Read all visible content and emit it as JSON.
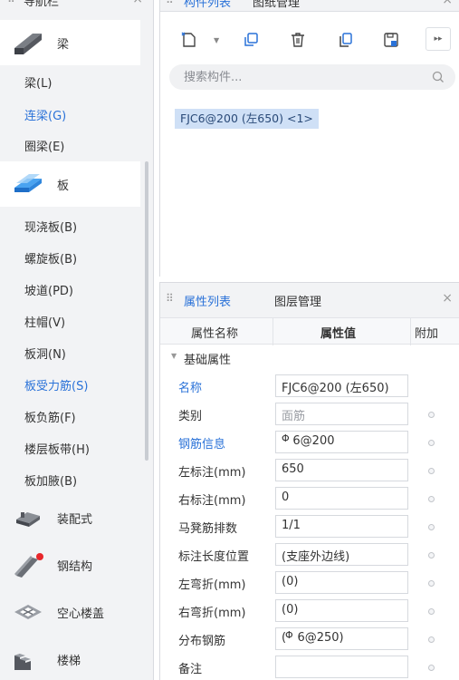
{
  "nav": {
    "title": "导航栏",
    "close": "×",
    "categories": [
      {
        "label": "梁"
      },
      {
        "label": "板"
      },
      {
        "label": "装配式"
      },
      {
        "label": "钢结构"
      },
      {
        "label": "空心楼盖"
      },
      {
        "label": "楼梯"
      }
    ],
    "beam_items": [
      {
        "label": "梁(L)"
      },
      {
        "label": "连梁(G)"
      },
      {
        "label": "圈梁(E)"
      }
    ],
    "slab_items": [
      {
        "label": "现浇板(B)"
      },
      {
        "label": "螺旋板(B)"
      },
      {
        "label": "坡道(PD)"
      },
      {
        "label": "柱帽(V)"
      },
      {
        "label": "板洞(N)"
      },
      {
        "label": "板受力筋(S)"
      },
      {
        "label": "板负筋(F)"
      },
      {
        "label": "楼层板带(H)"
      },
      {
        "label": "板加腋(B)"
      }
    ]
  },
  "component_panel": {
    "tabs": [
      {
        "label": "构件列表"
      },
      {
        "label": "图纸管理"
      }
    ],
    "close": "×",
    "more": "▸▸",
    "search_placeholder": "搜索构件...",
    "selected_item": "FJC6@200 (左650) <1>"
  },
  "property_panel": {
    "tabs": [
      {
        "label": "属性列表"
      },
      {
        "label": "图层管理"
      }
    ],
    "close": "×",
    "columns": {
      "name": "属性名称",
      "value": "属性值",
      "extra": "附加"
    },
    "group": "基础属性",
    "rows": [
      {
        "name": "名称",
        "value": "FJC6@200 (左650)"
      },
      {
        "name": "类别",
        "value": "面筋"
      },
      {
        "name": "钢筋信息",
        "value": "   6@200"
      },
      {
        "name": "左标注(mm)",
        "value": "650"
      },
      {
        "name": "右标注(mm)",
        "value": "0"
      },
      {
        "name": "马凳筋排数",
        "value": "1/1"
      },
      {
        "name": "标注长度位置",
        "value": "(支座外边线)"
      },
      {
        "name": "左弯折(mm)",
        "value": "(0)"
      },
      {
        "name": "右弯折(mm)",
        "value": "(0)"
      },
      {
        "name": "分布钢筋",
        "value": "(   6@250)"
      },
      {
        "name": "备注",
        "value": ""
      }
    ]
  },
  "colors": {
    "accent": "#2a72d8",
    "selected_bg": "#cfe0f6"
  }
}
